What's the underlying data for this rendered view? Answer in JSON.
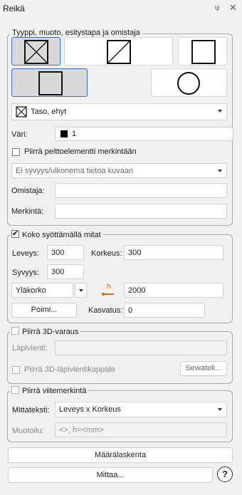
{
  "window": {
    "title": "Reikä",
    "pin_glyph": "⍦",
    "close_glyph": "✕"
  },
  "group_type": {
    "legend": "Tyyppi, muoto, esitystapa ja omistaja",
    "style_dropdown": {
      "value": "Taso, ehyt",
      "icon": "crossed-square-icon"
    },
    "color_label": "Väri:",
    "color_value": "1",
    "color_swatch": "#000000",
    "cover_checkbox_label": "Piirrä peittoelementti merkintään",
    "depth_dropdown": "Ei syvyys/ulkonema tietoa kuvaan",
    "owner_label": "Omistaja:",
    "owner_value": "",
    "marking_label": "Merkintä:",
    "marking_value": ""
  },
  "group_size": {
    "legend": "Koko syöttämällä mitat",
    "checked": true,
    "width_label": "Leveys:",
    "width_value": "300",
    "height_label": "Korkeus:",
    "height_value": "300",
    "depth_label": "Syvyys:",
    "depth_value": "300",
    "level_dropdown": "Yläkorko",
    "level_value": "2000",
    "level_icon_text": "h",
    "pick_button": "Poimi...",
    "growth_label": "Kasvatus:",
    "growth_value": "0"
  },
  "group_3d": {
    "legend": "Piirrä 3D-varaus",
    "penetration_label": "Läpivienti:",
    "penetration_value": "",
    "piece_checkbox_label": "Piirrä 3D-läpivientikappale",
    "sewatek_button": "Sewatek..."
  },
  "group_ref": {
    "legend": "Piirrä viitemerkintä",
    "dim_text_label": "Mittateksti:",
    "dim_text_value": "Leveys x Korkeus",
    "format_label": "Muotoilu:",
    "format_value": "<>, h=<mm>"
  },
  "buttons": {
    "quantity": "Määrälaskenta",
    "measure": "Mittaa...",
    "help": "?"
  },
  "colors": {
    "selection_border": "#3d6fd6",
    "accent": "#d46b1a"
  }
}
